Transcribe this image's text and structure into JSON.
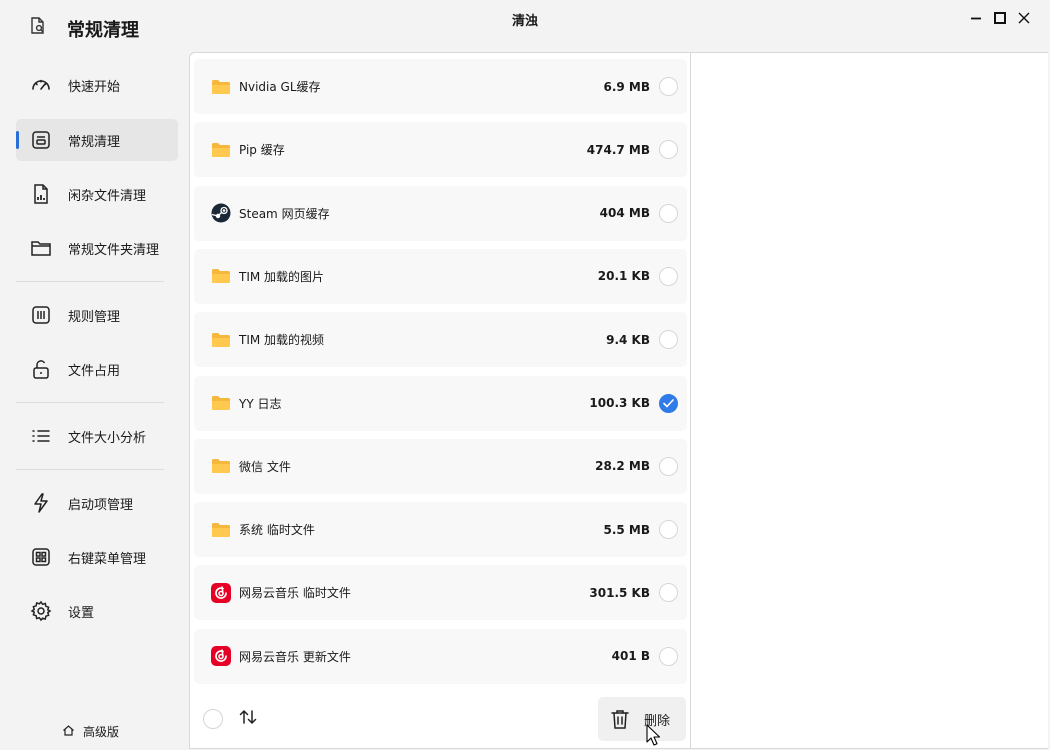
{
  "app": {
    "title": "常规清理",
    "window_title": "清浊"
  },
  "sidebar": {
    "items": [
      {
        "label": "快速开始",
        "icon": "gauge-icon"
      },
      {
        "label": "常规清理",
        "icon": "clean-box-icon",
        "active": true
      },
      {
        "label": "闲杂文件清理",
        "icon": "file-chart-icon"
      },
      {
        "label": "常规文件夹清理",
        "icon": "folder-icon"
      },
      {
        "label": "规则管理",
        "icon": "rules-icon"
      },
      {
        "label": "文件占用",
        "icon": "lock-open-icon"
      },
      {
        "label": "文件大小分析",
        "icon": "list-icon"
      },
      {
        "label": "启动项管理",
        "icon": "bolt-icon"
      },
      {
        "label": "右键菜单管理",
        "icon": "grid-icon"
      },
      {
        "label": "设置",
        "icon": "gear-icon"
      }
    ],
    "pro_label": "高级版"
  },
  "list": {
    "items": [
      {
        "name": "Nvidia GL缓存",
        "size": "6.9 MB",
        "icon": "folder-icon",
        "checked": false
      },
      {
        "name": "Pip 缓存",
        "size": "474.7 MB",
        "icon": "folder-icon",
        "checked": false
      },
      {
        "name": "Steam 网页缓存",
        "size": "404 MB",
        "icon": "steam-icon",
        "checked": false
      },
      {
        "name": "TIM 加载的图片",
        "size": "20.1 KB",
        "icon": "folder-icon",
        "checked": false
      },
      {
        "name": "TIM 加载的视频",
        "size": "9.4 KB",
        "icon": "folder-icon",
        "checked": false
      },
      {
        "name": "YY 日志",
        "size": "100.3 KB",
        "icon": "folder-icon",
        "checked": true
      },
      {
        "name": "微信 文件",
        "size": "28.2 MB",
        "icon": "folder-icon",
        "checked": false
      },
      {
        "name": "系统 临时文件",
        "size": "5.5 MB",
        "icon": "folder-icon",
        "checked": false
      },
      {
        "name": "网易云音乐 临时文件",
        "size": "301.5 KB",
        "icon": "netease-music-icon",
        "checked": false
      },
      {
        "name": "网易云音乐 更新文件",
        "size": "401 B",
        "icon": "netease-music-icon",
        "checked": false
      }
    ]
  },
  "footer": {
    "delete_label": "删除"
  },
  "colors": {
    "accent": "#2f7be8",
    "folder": "#f6b83c",
    "netease": "#e60026",
    "steam": "#1b2838"
  }
}
